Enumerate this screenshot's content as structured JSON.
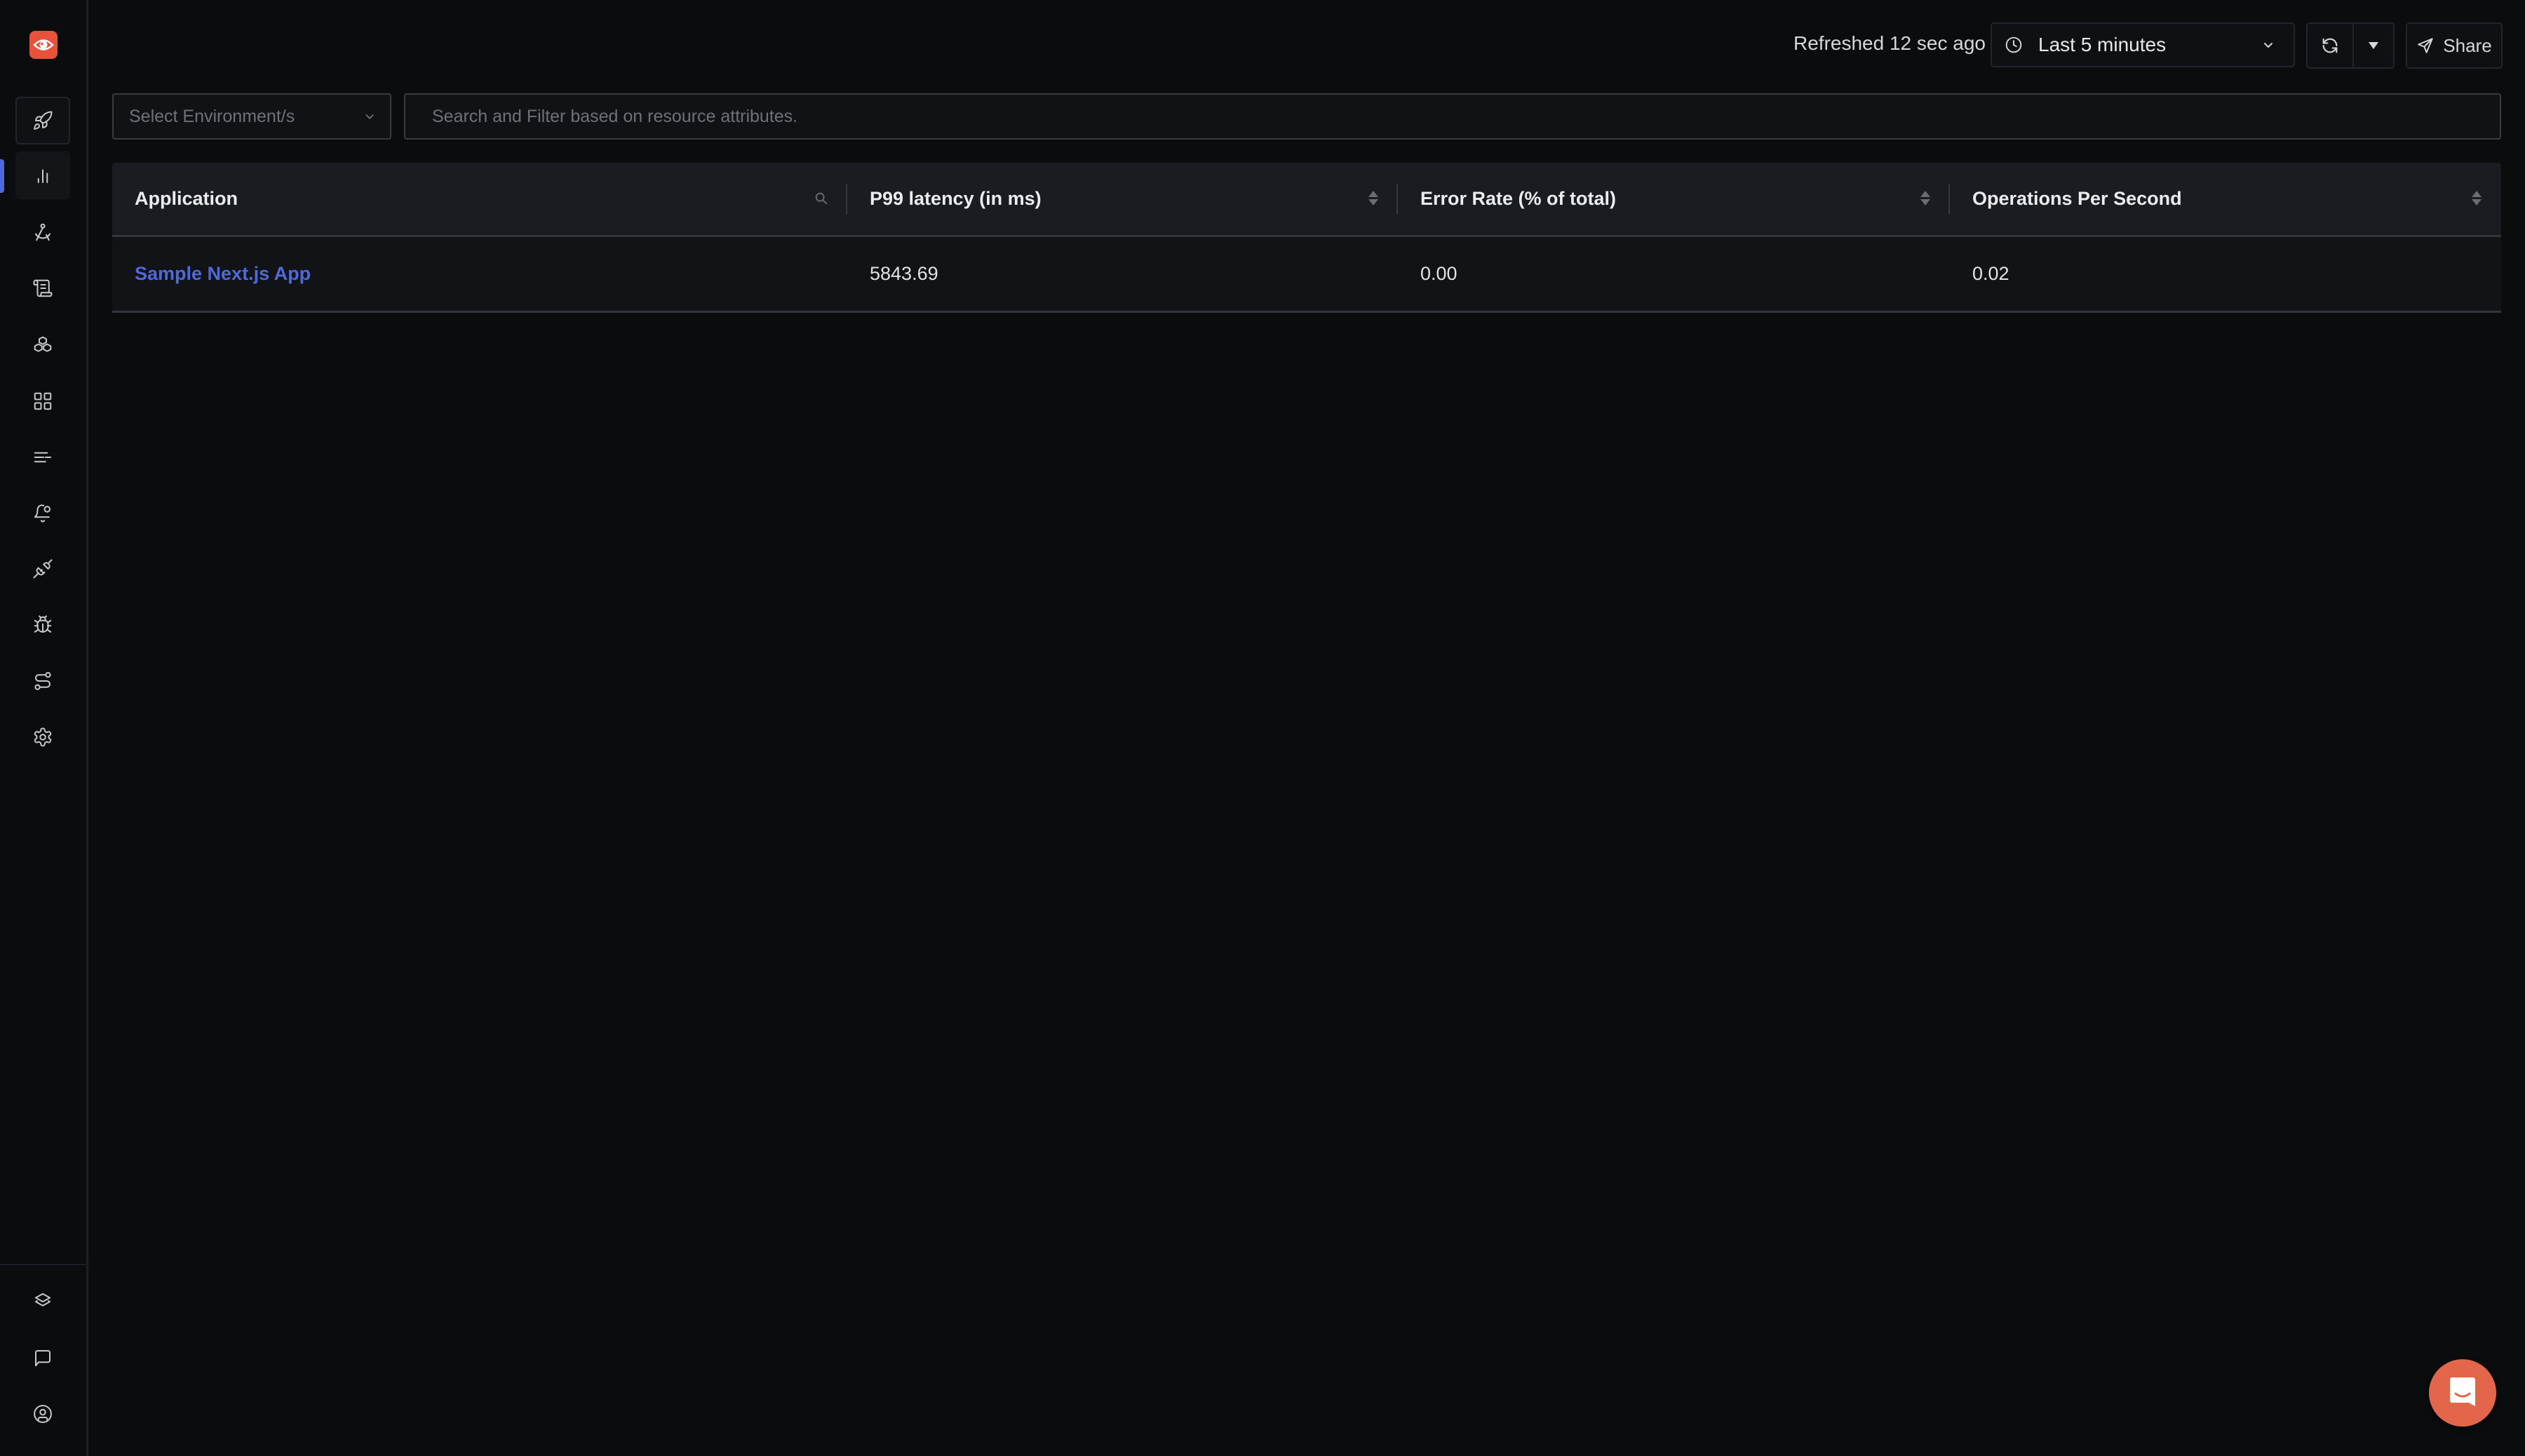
{
  "sidebar": {
    "logo": {
      "icon": "eye-logo-icon",
      "color": "#e8523a"
    },
    "nav_items": [
      {
        "name": "get-started",
        "icon": "rocket-icon",
        "state": "outlined"
      },
      {
        "name": "services",
        "icon": "bar-chart-icon",
        "state": "active"
      },
      {
        "name": "traces",
        "icon": "drafting-compass-icon"
      },
      {
        "name": "logs",
        "icon": "scroll-icon"
      },
      {
        "name": "infrastructure",
        "icon": "boxes-icon"
      },
      {
        "name": "dashboards",
        "icon": "grid-icon"
      },
      {
        "name": "messaging-queues",
        "icon": "list-lines-icon"
      },
      {
        "name": "alerts",
        "icon": "bell-dot-icon"
      },
      {
        "name": "integrations",
        "icon": "plug-icon"
      },
      {
        "name": "exceptions",
        "icon": "bug-icon"
      },
      {
        "name": "service-map",
        "icon": "route-icon"
      },
      {
        "name": "settings",
        "icon": "gear-icon"
      }
    ],
    "bottom_items": [
      {
        "name": "workspace",
        "icon": "layers-icon"
      },
      {
        "name": "support",
        "icon": "message-square-icon"
      },
      {
        "name": "profile",
        "icon": "user-circle-icon"
      }
    ],
    "accent_color": "#4e6ad8"
  },
  "topbar": {
    "refreshed_text": "Refreshed 12 sec ago",
    "time_range": "Last 5 minutes",
    "share_label": "Share"
  },
  "filters": {
    "environment_placeholder": "Select Environment/s",
    "search_placeholder": "Search and Filter based on resource attributes.",
    "search_value": ""
  },
  "table": {
    "columns": [
      {
        "label": "Application",
        "control": "search"
      },
      {
        "label": "P99 latency (in ms)",
        "control": "sort"
      },
      {
        "label": "Error Rate (% of total)",
        "control": "sort"
      },
      {
        "label": "Operations Per Second",
        "control": "sort"
      }
    ],
    "rows": [
      {
        "application": "Sample Next.js App",
        "p99": "5843.69",
        "error_rate": "0.00",
        "ops": "0.02"
      }
    ],
    "link_color": "#4e6ad8"
  },
  "chat_widget": {
    "icon": "chat-smile-icon",
    "color": "#e4664a"
  }
}
